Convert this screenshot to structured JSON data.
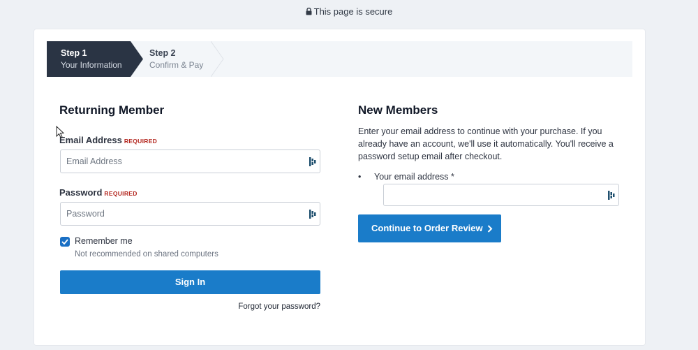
{
  "secure_bar": {
    "text": "This page is secure",
    "icon": "lock-icon"
  },
  "steps": [
    {
      "title": "Step 1",
      "subtitle": "Your Information",
      "active": true
    },
    {
      "title": "Step 2",
      "subtitle": "Confirm & Pay",
      "active": false
    }
  ],
  "returning": {
    "heading": "Returning Member",
    "email_label": "Email Address",
    "email_required": "REQUIRED",
    "email_placeholder": "Email Address",
    "password_label": "Password",
    "password_required": "REQUIRED",
    "password_placeholder": "Password",
    "remember_label": "Remember me",
    "remember_checked": true,
    "remember_hint": "Not recommended on shared computers",
    "sign_in_label": "Sign In",
    "forgot_label": "Forgot your password?"
  },
  "new_members": {
    "heading": "New Members",
    "description": "Enter your email address to continue with your purchase. If you already have an account, we'll use it automatically. You'll receive a password setup email after checkout.",
    "bullet": "•",
    "email_label": "Your email address *",
    "email_value": "",
    "continue_label": "Continue to Order Review"
  },
  "colors": {
    "accent": "#1a7cc9",
    "step_active_bg": "#2a3444",
    "required": "#b3261e",
    "page_bg": "#eef1f5"
  }
}
